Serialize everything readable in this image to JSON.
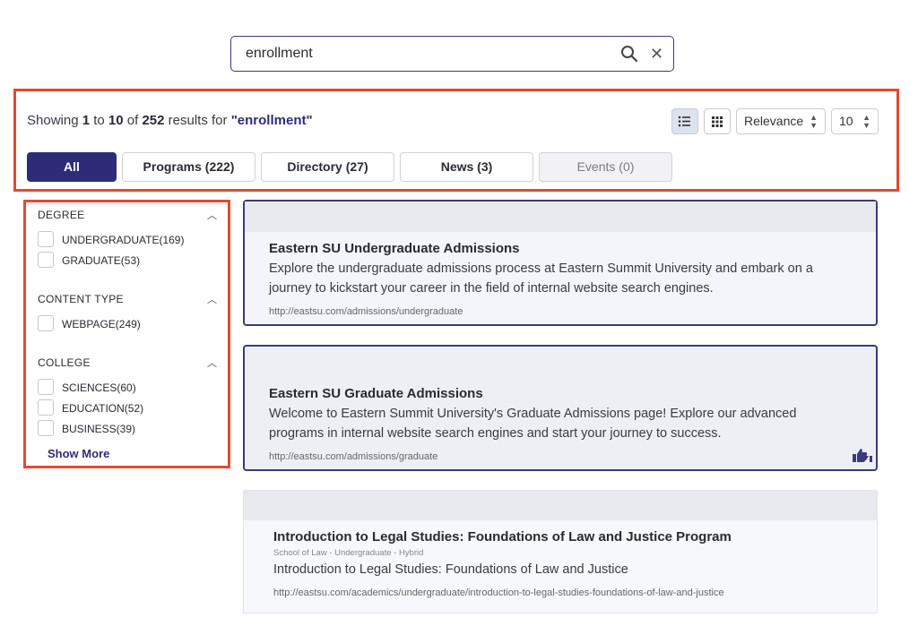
{
  "search": {
    "value": "enrollment",
    "placeholder": ""
  },
  "summary": {
    "prefix": "Showing ",
    "from": "1",
    "to_word": " to ",
    "to": "10",
    "of_word": " of ",
    "total": "252",
    "results_for": " results for ",
    "query": "\"enrollment\""
  },
  "controls": {
    "sort": "Relevance",
    "per_page": "10"
  },
  "tabs": [
    {
      "label": "All"
    },
    {
      "label": "Programs (222)"
    },
    {
      "label": "Directory (27)"
    },
    {
      "label": "News (3)"
    },
    {
      "label": "Events (0)"
    }
  ],
  "facets": [
    {
      "title": "DEGREE",
      "options": [
        {
          "label": "UNDERGRADUATE(169)"
        },
        {
          "label": "GRADUATE(53)"
        }
      ]
    },
    {
      "title": "CONTENT TYPE",
      "options": [
        {
          "label": "WEBPAGE(249)"
        }
      ]
    },
    {
      "title": "COLLEGE",
      "options": [
        {
          "label": "SCIENCES(60)"
        },
        {
          "label": "EDUCATION(52)"
        },
        {
          "label": "BUSINESS(39)"
        }
      ]
    }
  ],
  "show_more": "Show More",
  "results": [
    {
      "title": "Eastern SU Undergraduate Admissions",
      "desc_line1": "Explore the undergraduate admissions process at Eastern Summit University and embark on a",
      "desc_line2": "journey to kickstart your career in the field of internal website search engines.",
      "url": "http://eastsu.com/admissions/undergraduate"
    },
    {
      "title": "Eastern SU Graduate Admissions",
      "desc_line1": "Welcome to Eastern Summit University's Graduate Admissions page! Explore our advanced",
      "desc_line2": "programs in internal website search engines and start your journey to success.",
      "url": "http://eastsu.com/admissions/graduate",
      "icon": "thumbs-feedback-icon"
    },
    {
      "title": "Introduction to Legal Studies: Foundations of Law and Justice Program",
      "meta": "School of Law  -  Undergraduate  -  Hybrid",
      "desc_line1": "Introduction to Legal Studies: Foundations of Law and Justice",
      "url": "http://eastsu.com/academics/undergraduate/introduction-to-legal-studies-foundations-of-law-and-justice"
    }
  ],
  "colors": {
    "accent": "#2e2c78",
    "highlight_box": "#e34a31"
  }
}
